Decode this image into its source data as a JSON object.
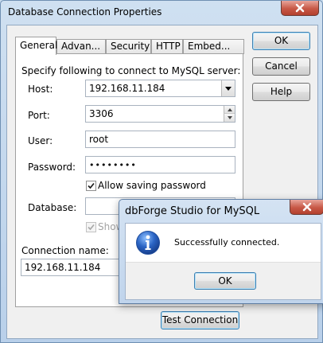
{
  "window": {
    "title": "Database Connection Properties",
    "close_icon": "close-icon"
  },
  "tabs": [
    {
      "label": "General"
    },
    {
      "label": "Advan..."
    },
    {
      "label": "Security"
    },
    {
      "label": "HTTP"
    },
    {
      "label": "Embed..."
    }
  ],
  "general": {
    "intro": "Specify following to connect to MySQL server:",
    "host_label": "Host:",
    "host_value": "192.168.11.184",
    "port_label": "Port:",
    "port_value": "3306",
    "user_label": "User:",
    "user_value": "root",
    "password_label": "Password:",
    "password_value": "••••••••",
    "allow_saving_label": "Allow saving password",
    "allow_saving_checked": true,
    "database_label": "Database:",
    "database_value": "",
    "show_label": "Show",
    "connection_name_label": "Connection name:",
    "connection_name_value": "192.168.11.184"
  },
  "buttons": {
    "ok": "OK",
    "cancel": "Cancel",
    "help": "Help",
    "test_connection": "Test Connection"
  },
  "popup": {
    "title": "dbForge Studio for MySQL",
    "message": "Successfully connected.",
    "ok": "OK",
    "icon": "info-icon"
  },
  "colors": {
    "info_blue": "#2a64c4",
    "close_red": "#c75846",
    "default_border": "#3c7fb1"
  }
}
